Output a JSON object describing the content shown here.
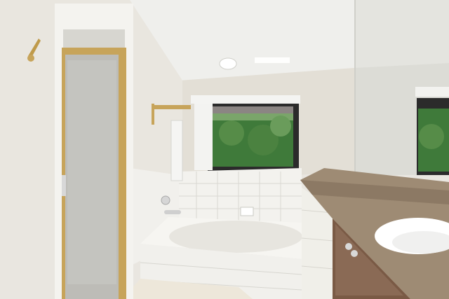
{
  "photo": {
    "scene": "bathroom-interior",
    "colors": {
      "ceiling": "#efefec",
      "wall": "#e6e3dc",
      "tile": "#f3f2ee",
      "granite": "#9e8b74",
      "cabinet": "#7a5a45",
      "brass": "#c7a45a",
      "foliage": "#3f7a3a"
    }
  }
}
